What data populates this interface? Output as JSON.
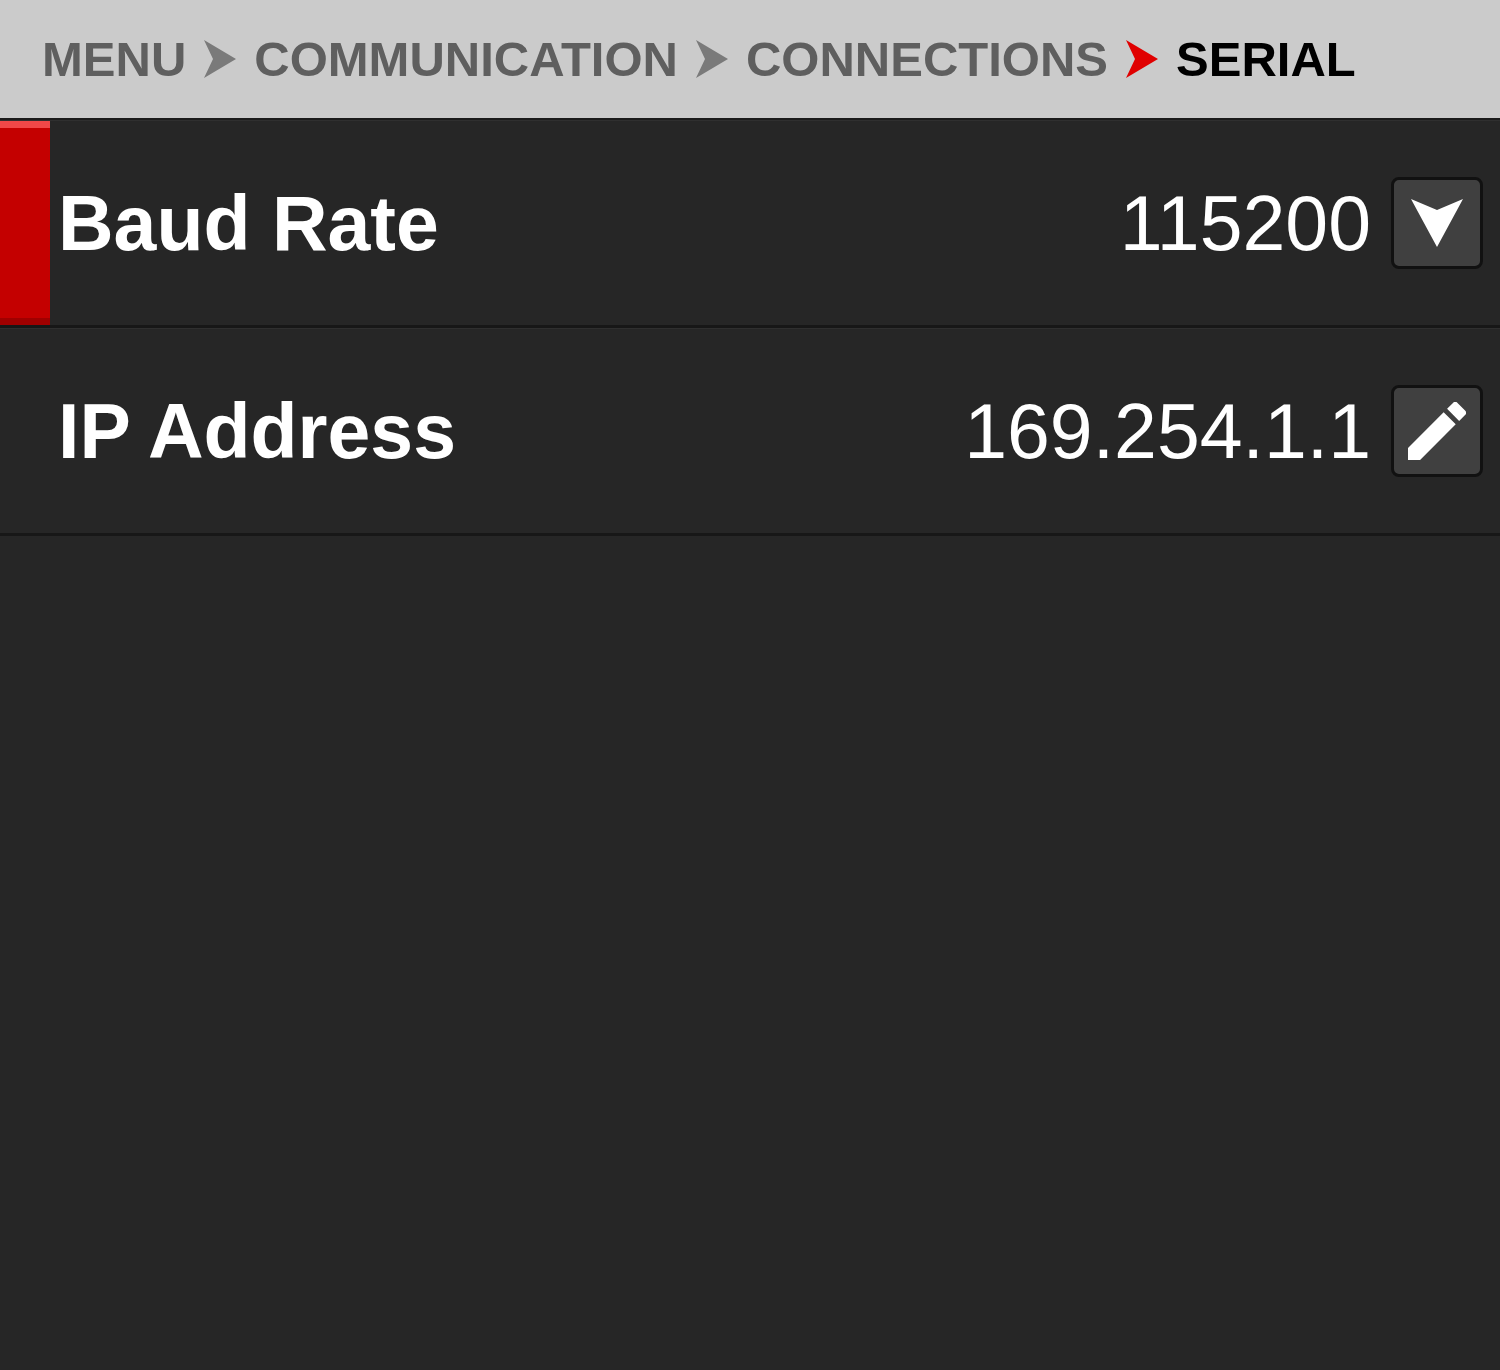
{
  "breadcrumb": [
    {
      "label": "MENU",
      "selected": false
    },
    {
      "label": "COMMUNICATION",
      "selected": false
    },
    {
      "label": "CONNECTIONS",
      "selected": false
    },
    {
      "label": "SERIAL",
      "selected": true
    }
  ],
  "rows": [
    {
      "label": "Baud Rate",
      "value": "115200",
      "kind": "dropdown",
      "selected": true
    },
    {
      "label": "IP Address",
      "value": "169.254.1.1",
      "kind": "edit",
      "selected": false
    }
  ]
}
